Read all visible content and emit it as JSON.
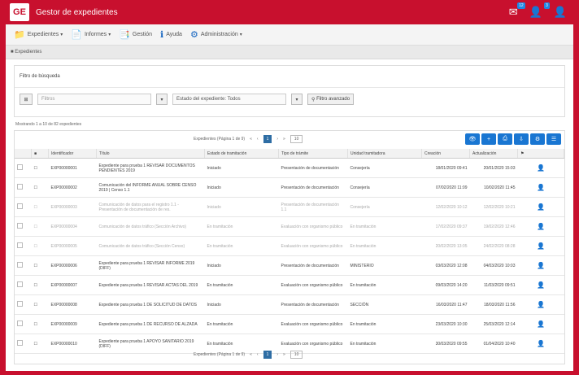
{
  "app": {
    "title": "Gestor de expedientes",
    "logo_text": "GE"
  },
  "header_icons": [
    {
      "name": "notifications-icon",
      "glyph": "✉",
      "badge": "12"
    },
    {
      "name": "user-icon",
      "glyph": "👤",
      "badge": "3"
    },
    {
      "name": "account-icon",
      "glyph": "👤",
      "badge": ""
    }
  ],
  "menu": [
    {
      "label": "Expedientes",
      "glyph": "📁"
    },
    {
      "label": "Informes",
      "glyph": "📄"
    },
    {
      "label": "Gestión",
      "glyph": "📑"
    },
    {
      "label": "Ayuda",
      "glyph": "ℹ"
    },
    {
      "label": "Administración",
      "glyph": "⚙"
    }
  ],
  "breadcrumb": "Expedientes",
  "filters": {
    "title": "Filtro de búsqueda",
    "field1_placeholder": "Filtros",
    "field2_value": "Estado del expediente: Todos",
    "search_button": "Filtro avanzado"
  },
  "results_info": "Mostrando 1 a 10 de 82 expedientes",
  "pager": {
    "label": "Expedientes (Página 1 de 9)",
    "current": "1",
    "per_page": "10"
  },
  "columns": [
    "",
    "",
    "Identificador",
    "Título",
    "Estado de tramitación",
    "Tipo de trámite",
    "Unidad tramitadora",
    "Creación",
    "Actualización",
    ""
  ],
  "rows": [
    {
      "id": "EXP00000001",
      "title": "Expediente para prueba 1 REVISAR DOCUMENTOS PENDIENTES 2019",
      "status": "Iniciado",
      "type": "Presentación de documentación",
      "unit": "Consejería",
      "created": "18/01/2020 09:41",
      "updated": "20/01/2020 15:03",
      "dim": false
    },
    {
      "id": "EXP00000002",
      "title": "Comunicación del INFORME ANUAL SOBRE CENSO 2019 | Censo 1.1",
      "status": "Iniciado",
      "type": "Presentación de documentación",
      "unit": "Consejería",
      "created": "07/02/2020 11:09",
      "updated": "10/02/2020 11:45",
      "dim": false
    },
    {
      "id": "EXP00000003",
      "title": "Comunicación de datos para el registro 1.1 - Presentación de documentación de res.",
      "status": "Iniciado",
      "type": "Presentación de documentación 1.1",
      "unit": "Consejería",
      "created": "12/02/2020 10:12",
      "updated": "12/02/2020 10:21",
      "dim": true
    },
    {
      "id": "EXP00000004",
      "title": "Comunicación de datos tráfico (Sección Archivo)",
      "status": "En tramitación",
      "type": "Evaluación con organismo público",
      "unit": "En tramitación",
      "created": "17/02/2020 09:37",
      "updated": "19/02/2020 12:46",
      "dim": true
    },
    {
      "id": "EXP00000005",
      "title": "Comunicación de datos tráfico (Sección Censo)",
      "status": "En tramitación",
      "type": "Evaluación con organismo público",
      "unit": "En tramitación",
      "created": "20/02/2020 13:05",
      "updated": "24/02/2020 08:28",
      "dim": true
    },
    {
      "id": "EXP00000006",
      "title": "Expediente para prueba 1 REVISAR INFORME 2019 (DIFF)",
      "status": "Iniciado",
      "type": "Presentación de documentación",
      "unit": "MINISTERIO",
      "created": "03/03/2020 12:08",
      "updated": "04/03/2020 10:03",
      "dim": false
    },
    {
      "id": "EXP00000007",
      "title": "Expediente para prueba 1 REVISAR ACTAS DEL 2019",
      "status": "En tramitación",
      "type": "Evaluación con organismo público",
      "unit": "En tramitación",
      "created": "09/03/2020 14:20",
      "updated": "11/03/2020 09:51",
      "dim": false
    },
    {
      "id": "EXP00000008",
      "title": "Expediente para prueba 1 DE SOLICITUD DE DATOS",
      "status": "Iniciado",
      "type": "Presentación de documentación",
      "unit": "SECCIÓN",
      "created": "16/03/2020 11:47",
      "updated": "18/03/2020 11:56",
      "dim": false
    },
    {
      "id": "EXP00000009",
      "title": "Expediente para prueba 1 DE RECURSO DE ALZADA",
      "status": "En tramitación",
      "type": "Evaluación con organismo público",
      "unit": "En tramitación",
      "created": "23/03/2020 10:30",
      "updated": "25/03/2020 12:14",
      "dim": false
    },
    {
      "id": "EXP00000010",
      "title": "Expediente para prueba 1 APOYO SANITARIO 2019 (DIFF)",
      "status": "En tramitación",
      "type": "Evaluación con organismo público",
      "unit": "En tramitación",
      "created": "30/03/2020 09:55",
      "updated": "01/04/2020 10:40",
      "dim": false
    }
  ],
  "toolbar_buttons": [
    "view-icon",
    "add-icon",
    "print-icon",
    "export-icon",
    "config-icon",
    "list-icon"
  ],
  "colors": {
    "brand": "#c8102e",
    "accent": "#1976d2"
  }
}
